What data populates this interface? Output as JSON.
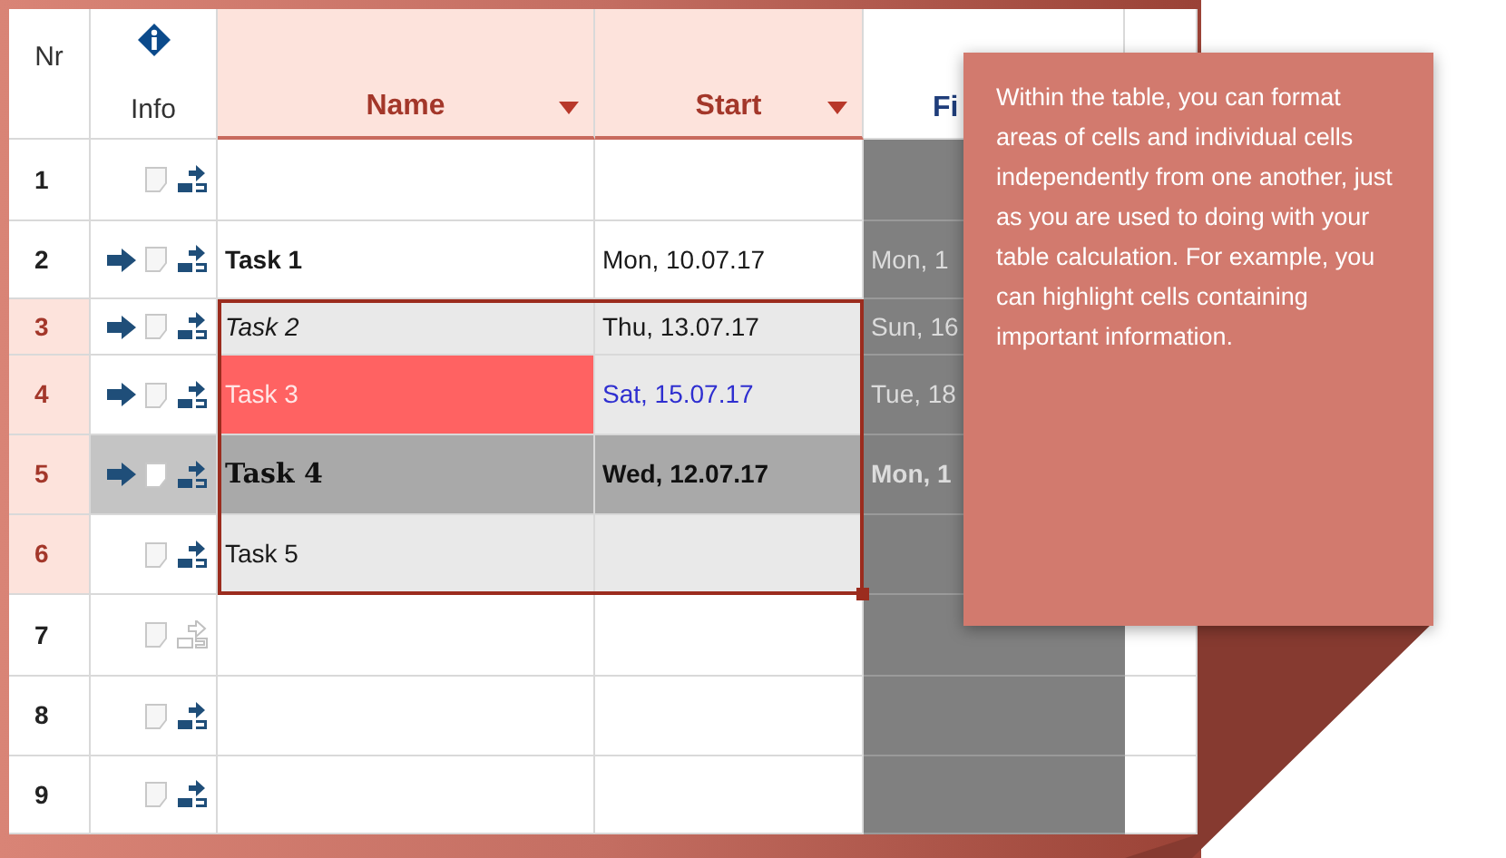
{
  "table": {
    "columns": [
      {
        "label": "Nr",
        "kind": "plain"
      },
      {
        "label": "Info",
        "kind": "info"
      },
      {
        "label": "Name",
        "kind": "sortable"
      },
      {
        "label": "Start",
        "kind": "sortable"
      },
      {
        "label": "Fi",
        "kind": "partial"
      }
    ],
    "rows": [
      {
        "nr": "1",
        "highlighted": false,
        "arrow": false,
        "link_enabled": true,
        "shaded": false,
        "selected": false,
        "name": {
          "kind": "plain"
        },
        "start": {
          "kind": "plain"
        },
        "finish": {
          "bold": false
        }
      },
      {
        "nr": "2",
        "highlighted": false,
        "arrow": true,
        "link_enabled": true,
        "shaded": false,
        "selected": false,
        "name": {
          "text": "Task 1",
          "kind": "bold"
        },
        "start": {
          "text": "Mon, 10.07.17",
          "kind": "plain"
        },
        "finish": {
          "text": "Mon, 1",
          "bold": false
        }
      },
      {
        "nr": "3",
        "highlighted": true,
        "arrow": true,
        "link_enabled": true,
        "shaded": false,
        "selected": true,
        "name": {
          "text": "Task 2",
          "kind": "italic"
        },
        "start": {
          "text": "Thu, 13.07.17",
          "kind": "grey"
        },
        "finish": {
          "text": "Sun, 16",
          "bold": false
        }
      },
      {
        "nr": "4",
        "highlighted": true,
        "arrow": true,
        "link_enabled": true,
        "shaded": false,
        "selected": true,
        "name": {
          "text": "Task 3",
          "kind": "alert"
        },
        "start": {
          "text": "Sat, 15.07.17",
          "kind": "blue"
        },
        "finish": {
          "text": "Tue, 18",
          "bold": false
        }
      },
      {
        "nr": "5",
        "highlighted": true,
        "arrow": true,
        "link_enabled": true,
        "shaded": true,
        "selected": true,
        "name": {
          "text": "Task 4",
          "kind": "serif"
        },
        "start": {
          "text": "Wed, 12.07.17",
          "kind": "dark"
        },
        "finish": {
          "text": "Mon, 1",
          "bold": true
        }
      },
      {
        "nr": "6",
        "highlighted": true,
        "arrow": false,
        "link_enabled": true,
        "shaded": false,
        "selected": true,
        "name": {
          "text": "Task 5",
          "kind": "grey"
        },
        "start": {
          "kind": "grey"
        },
        "finish": {
          "bold": false
        }
      },
      {
        "nr": "7",
        "highlighted": false,
        "arrow": false,
        "link_enabled": false,
        "shaded": false,
        "selected": false,
        "name": {
          "kind": "plain"
        },
        "start": {
          "kind": "plain"
        },
        "finish": {
          "bold": false
        }
      },
      {
        "nr": "8",
        "highlighted": false,
        "arrow": false,
        "link_enabled": true,
        "shaded": false,
        "selected": false,
        "name": {
          "kind": "plain"
        },
        "start": {
          "kind": "plain"
        },
        "finish": {
          "bold": false
        }
      },
      {
        "nr": "9",
        "highlighted": false,
        "arrow": false,
        "link_enabled": true,
        "shaded": false,
        "selected": false,
        "name": {
          "kind": "plain"
        },
        "start": {
          "kind": "plain"
        },
        "finish": {
          "bold": false
        }
      }
    ]
  },
  "callout": {
    "text": "Within the table, you can format areas of cells and individual cells independently from one another, just as you are used to doing with your table calculation. For example, you can highlight cells containing important information."
  }
}
